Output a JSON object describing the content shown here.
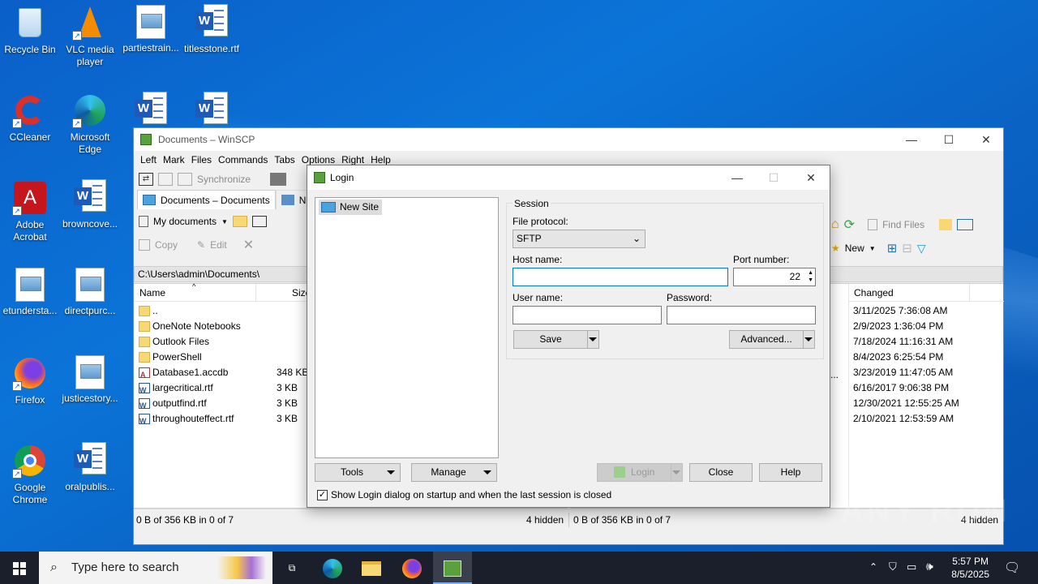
{
  "desktop": {
    "icons": [
      {
        "label": "Recycle Bin"
      },
      {
        "label": "VLC media player"
      },
      {
        "label": "partiestrain..."
      },
      {
        "label": "titlesstone.rtf"
      },
      {
        "label": "CCleaner"
      },
      {
        "label": "Microsoft Edge"
      },
      {
        "label": "po"
      },
      {
        "label": "Adobe Acrobat"
      },
      {
        "label": "browncove..."
      },
      {
        "label": "p"
      },
      {
        "label": "etundersta..."
      },
      {
        "label": "directpurc..."
      },
      {
        "label": "se"
      },
      {
        "label": "Firefox"
      },
      {
        "label": "justicestory..."
      },
      {
        "label": "st"
      },
      {
        "label": "Google Chrome"
      },
      {
        "label": "oralpublis..."
      },
      {
        "label": "st"
      }
    ]
  },
  "winscp": {
    "title": "Documents – WinSCP",
    "menu": [
      "Left",
      "Mark",
      "Files",
      "Commands",
      "Tabs",
      "Options",
      "Right",
      "Help"
    ],
    "toolbar": {
      "synchronize": "Synchronize"
    },
    "tab_label": "Documents – Documents",
    "tab_new": "N",
    "left_location": "My documents",
    "left_actions": {
      "copy": "Copy",
      "edit": "Edit"
    },
    "right_actions": {
      "find_files": "Find Files",
      "new": "New"
    },
    "left_path": "C:\\Users\\admin\\Documents\\",
    "left_columns": {
      "name": "Name",
      "size": "Size"
    },
    "right_columns": {
      "changed": "Changed"
    },
    "files": [
      {
        "name": "..",
        "size": "",
        "type": "up"
      },
      {
        "name": "OneNote Notebooks",
        "size": "",
        "type": "folder"
      },
      {
        "name": "Outlook Files",
        "size": "",
        "type": "folder"
      },
      {
        "name": "PowerShell",
        "size": "",
        "type": "folder"
      },
      {
        "name": "Database1.accdb",
        "size": "348 KB",
        "type": "accdb"
      },
      {
        "name": "largecritical.rtf",
        "size": "3 KB",
        "type": "rtf"
      },
      {
        "name": "outputfind.rtf",
        "size": "3 KB",
        "type": "rtf"
      },
      {
        "name": "throughouteffect.rtf",
        "size": "3 KB",
        "type": "rtf"
      }
    ],
    "changed": [
      "3/11/2025 7:36:08 AM",
      "2/9/2023 1:36:04 PM",
      "7/18/2024 11:16:31 AM",
      "8/4/2023 6:25:54 PM",
      "3/23/2019 11:47:05 AM",
      "6/16/2017 9:06:38 PM",
      "12/30/2021 12:55:25 AM",
      "2/10/2021 12:53:59 AM"
    ],
    "right_ellipsis": "...",
    "status_left": "0 B of 356 KB in 0 of 7",
    "status_left_hidden": "4 hidden",
    "status_right": "0 B of 356 KB in 0 of 7",
    "status_right_hidden": "4 hidden"
  },
  "login": {
    "title": "Login",
    "site": "New Site",
    "session_label": "Session",
    "protocol_label": "File protocol:",
    "protocol_value": "SFTP",
    "host_label": "Host name:",
    "host_value": "",
    "port_label": "Port number:",
    "port_value": "22",
    "user_label": "User name:",
    "user_value": "",
    "password_label": "Password:",
    "password_value": "",
    "save": "Save",
    "advanced": "Advanced...",
    "tools": "Tools",
    "manage": "Manage",
    "login": "Login",
    "close": "Close",
    "help": "Help",
    "show_login_checkbox": "Show Login dialog on startup and when the last session is closed",
    "show_login_checked": true
  },
  "taskbar": {
    "search_placeholder": "Type here to search",
    "time": "5:57 PM",
    "date": "8/5/2025"
  },
  "watermark": "ANY RUN"
}
